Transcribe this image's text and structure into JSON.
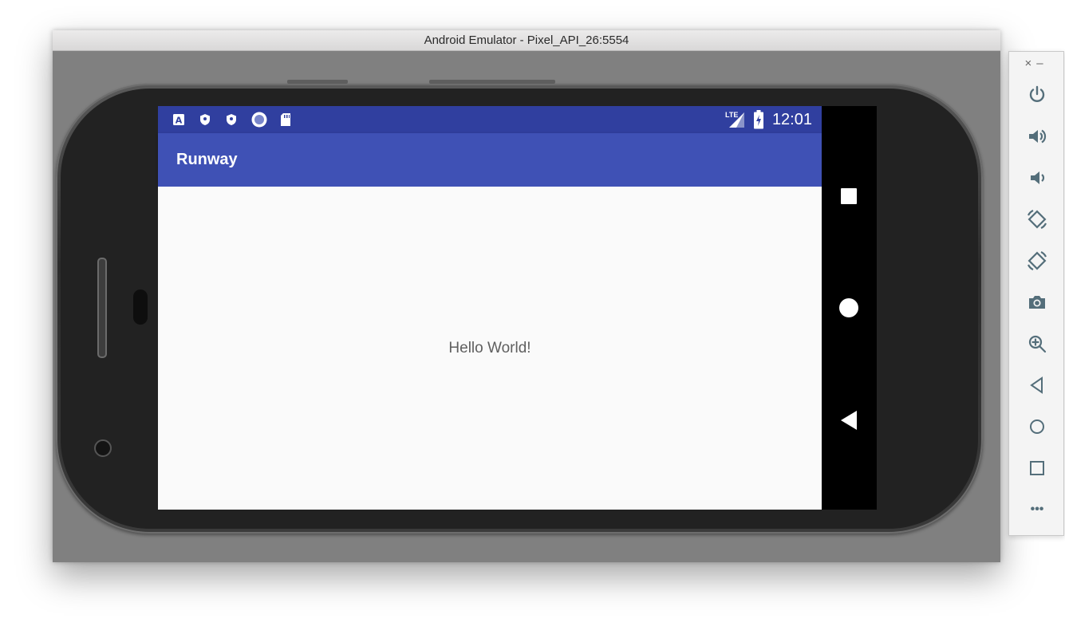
{
  "window": {
    "title": "Android Emulator - Pixel_API_26:5554"
  },
  "statusbar": {
    "icons": [
      "accessibility-a-icon",
      "shield-icon",
      "shield-icon",
      "circle-record-icon",
      "sd-card-icon"
    ],
    "network": "LTE",
    "time": "12:01"
  },
  "app": {
    "title": "Runway",
    "body_text": "Hello World!"
  },
  "navbar": {
    "buttons": [
      "recents-square-icon",
      "home-circle-icon",
      "back-triangle-icon"
    ]
  },
  "toolbar": {
    "window_controls": {
      "close": "×",
      "minimize": "–"
    },
    "buttons": [
      "power-icon",
      "volume-up-icon",
      "volume-down-icon",
      "rotate-left-icon",
      "rotate-right-icon",
      "camera-icon",
      "zoom-icon",
      "back-icon",
      "home-icon",
      "overview-icon",
      "more-icon"
    ],
    "more_label": "•••"
  },
  "colors": {
    "statusbar": "#303F9F",
    "appbar": "#3F51B5",
    "content_bg": "#FAFAFA",
    "toolbar_icon": "#546E7A",
    "emulator_bg": "#808080"
  }
}
